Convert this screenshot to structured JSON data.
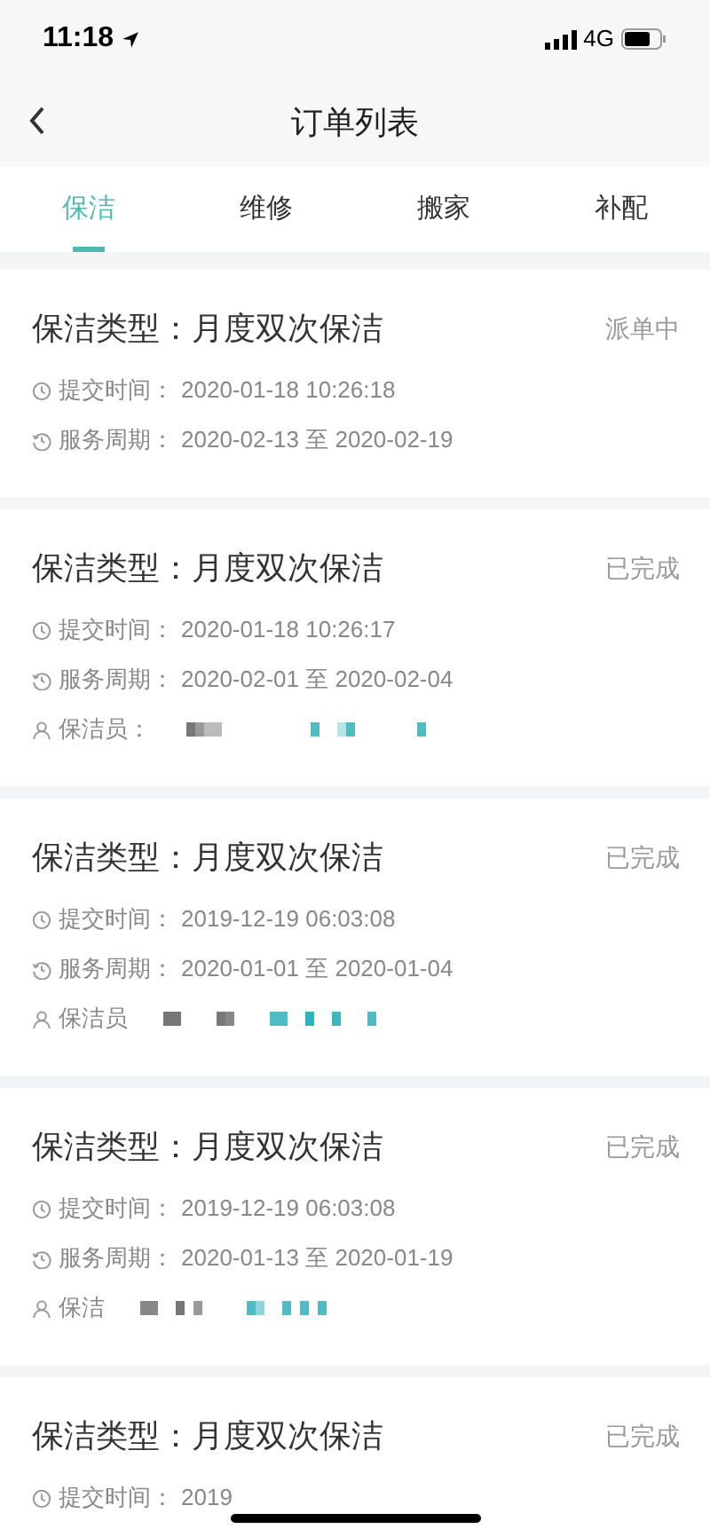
{
  "status_bar": {
    "time": "11:18",
    "network": "4G"
  },
  "nav": {
    "title": "订单列表"
  },
  "tabs": [
    {
      "label": "保洁",
      "selected": true
    },
    {
      "label": "维修",
      "selected": false
    },
    {
      "label": "搬家",
      "selected": false
    },
    {
      "label": "补配",
      "selected": false
    }
  ],
  "orders": [
    {
      "type_label": "保洁类型：",
      "type": "月度双次保洁",
      "status": "派单中",
      "submit_label": "提交时间：",
      "submit_time": "2020-01-18 10:26:18",
      "period_label": "服务周期：",
      "period": "2020-02-13 至 2020-02-19"
    },
    {
      "type_label": "保洁类型：",
      "type": "月度双次保洁",
      "status": "已完成",
      "submit_label": "提交时间：",
      "submit_time": "2020-01-18 10:26:17",
      "period_label": "服务周期：",
      "period": "2020-02-01 至 2020-02-04",
      "cleaner_label": "保洁员："
    },
    {
      "type_label": "保洁类型：",
      "type": "月度双次保洁",
      "status": "已完成",
      "submit_label": "提交时间：",
      "submit_time": "2019-12-19 06:03:08",
      "period_label": "服务周期：",
      "period": "2020-01-01 至 2020-01-04",
      "cleaner_label": "保洁员"
    },
    {
      "type_label": "保洁类型：",
      "type": "月度双次保洁",
      "status": "已完成",
      "submit_label": "提交时间：",
      "submit_time": "2019-12-19 06:03:08",
      "period_label": "服务周期：",
      "period": "2020-01-13 至 2020-01-19",
      "cleaner_label": "保洁"
    },
    {
      "type_label": "保洁类型：",
      "type": "月度双次保洁",
      "status": "已完成",
      "submit_label": "提交时间：",
      "submit_time": "2019"
    }
  ]
}
